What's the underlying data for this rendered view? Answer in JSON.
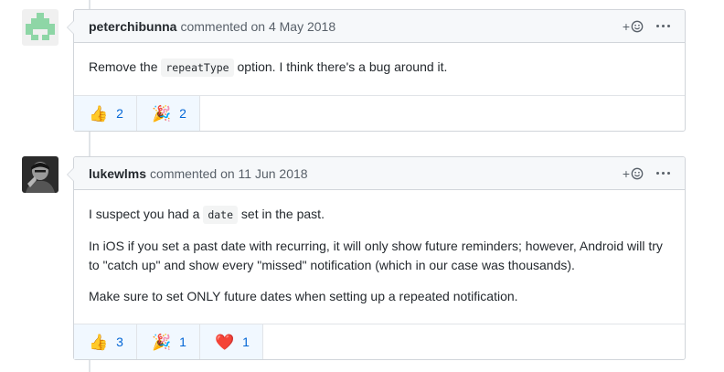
{
  "comments": [
    {
      "author": "peterchibunna",
      "action": "commented on",
      "date": "4 May 2018",
      "body": {
        "p1_before": "Remove the ",
        "p1_code": "repeatType",
        "p1_after": " option. I think there's a bug around it."
      },
      "reactions": [
        {
          "emoji": "👍",
          "name": "thumbs-up",
          "count": "2"
        },
        {
          "emoji": "🎉",
          "name": "hooray",
          "count": "2"
        }
      ]
    },
    {
      "author": "lukewlms",
      "action": "commented on",
      "date": "11 Jun 2018",
      "body": {
        "p1_before": "I suspect you had a ",
        "p1_code": "date",
        "p1_after": " set in the past.",
        "p2": "In iOS if you set a past date with recurring, it will only show future reminders; however, Android will try to \"catch up\" and show every \"missed\" notification (which in our case was thousands).",
        "p3": "Make sure to set ONLY future dates when setting up a repeated notification."
      },
      "reactions": [
        {
          "emoji": "👍",
          "name": "thumbs-up",
          "count": "3"
        },
        {
          "emoji": "🎉",
          "name": "hooray",
          "count": "1"
        },
        {
          "emoji": "❤️",
          "name": "heart",
          "count": "1"
        }
      ]
    }
  ],
  "header_actions": {
    "add_reaction": "+",
    "add_reaction_icon": "smiley-icon",
    "more_icon": "kebab-icon"
  },
  "colors": {
    "accent": "#0366d6",
    "header_bg": "#f6f8fa",
    "border": "#d1d5da",
    "identicon": "#8ed6a6"
  }
}
